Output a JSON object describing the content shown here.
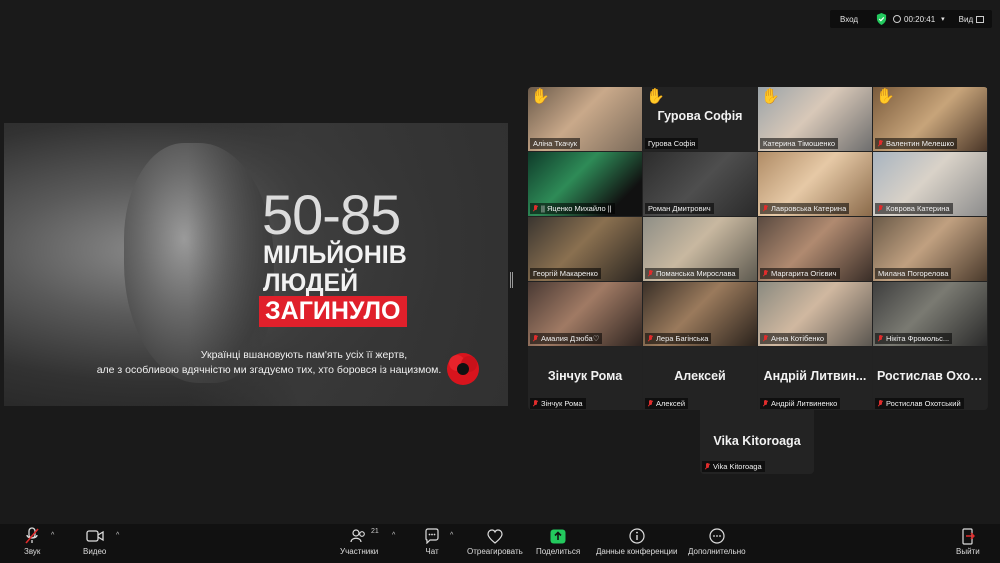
{
  "topbar": {
    "enter_label": "Вход",
    "timer": "00:20:41",
    "view_label": "Вид"
  },
  "share": {
    "number": "50-85",
    "line2": "МІЛЬЙОНІВ",
    "line3": "ЛЮДЕЙ",
    "line4": "ЗАГИНУЛО",
    "caption1": "Українці вшановують пам'ять усіх її жертв,",
    "caption2": "але з особливою вдячністю ми згадуємо тих, хто боровся із нацизмом."
  },
  "participants": [
    {
      "name": "Аліна Ткачук",
      "muted": false,
      "hand": true,
      "photo": "linear-gradient(135deg,#6b5a4a,#c9a98a 45%,#7a6a5a)"
    },
    {
      "name": "Гурова Софія",
      "muted": false,
      "hand": true,
      "display": "Гурова Софія"
    },
    {
      "name": "Катерина Тімошенко",
      "muted": false,
      "hand": true,
      "photo": "linear-gradient(135deg,#9aa3a8,#d8c8b8 45%,#6e6e6e)"
    },
    {
      "name": "Валентин Мелешко",
      "muted": true,
      "hand": true,
      "photo": "linear-gradient(135deg,#7a5b3c,#c7a47a 50%,#4a3628)"
    },
    {
      "name": "|| Яценко Михайло ||",
      "muted": true,
      "hand": false,
      "photo": "linear-gradient(135deg,#0f3b2a,#2e8b57 40%,#111 80%)"
    },
    {
      "name": "Роман Дмитрович",
      "muted": false,
      "hand": false,
      "photo": "linear-gradient(135deg,#2c2c2c,#4e4e4e 50%,#2a2a2a)"
    },
    {
      "name": "Лавровська Катерина",
      "muted": true,
      "hand": false,
      "photo": "linear-gradient(135deg,#b08c66,#e6c9a6 45%,#8a6a4a)"
    },
    {
      "name": "Коврова Катерина",
      "muted": true,
      "hand": false,
      "photo": "linear-gradient(135deg,#a8b4c0,#d9d2c8 45%,#8c8c8c)"
    },
    {
      "name": "Георгій Макаренко",
      "muted": false,
      "hand": false,
      "photo": "linear-gradient(135deg,#3a3530,#8a7050 45%,#2a2520)"
    },
    {
      "name": "Поманська Мирослава",
      "muted": true,
      "hand": false,
      "photo": "linear-gradient(135deg,#8e8e86,#c8b8a0 45%,#5e5a50)"
    },
    {
      "name": "Маргарита Огієвич",
      "muted": true,
      "hand": false,
      "photo": "linear-gradient(135deg,#5a4a40,#b08a70 45%,#3a2e28)"
    },
    {
      "name": "Милана Погорелова",
      "muted": false,
      "hand": false,
      "photo": "linear-gradient(135deg,#6a5a48,#c0a080 45%,#4a3a2c)"
    },
    {
      "name": "Амалия Дзюба♡",
      "muted": true,
      "hand": false,
      "photo": "linear-gradient(135deg,#4a3a34,#a07a64 45%,#2e2420)"
    },
    {
      "name": "Лера Багінська",
      "muted": true,
      "hand": false,
      "active": true,
      "photo": "linear-gradient(135deg,#3a3028,#9a7a5c 45%,#2a221c)"
    },
    {
      "name": "Анна Котібенко",
      "muted": true,
      "hand": false,
      "photo": "linear-gradient(135deg,#8a8a80,#d0b8a0 45%,#5a5650)"
    },
    {
      "name": "Нікіта Фромольс...",
      "muted": true,
      "hand": false,
      "photo": "linear-gradient(135deg,#3e3e3e,#7a7a72 45%,#2a2a2a)"
    },
    {
      "name": "Зінчук Рома",
      "muted": true,
      "hand": false,
      "display": "Зінчук Рома"
    },
    {
      "name": "Алексей",
      "muted": true,
      "hand": false,
      "display": "Алексей"
    },
    {
      "name": "Андрій Литвиненко",
      "muted": true,
      "hand": false,
      "display": "Андрій Литвин..."
    },
    {
      "name": "Ростислав Охотський",
      "muted": true,
      "hand": false,
      "display": "Ростислав Охот..."
    }
  ],
  "extra_participant": {
    "name": "Vika Kitoroaga",
    "display": "Vika Kitoroaga",
    "muted": true
  },
  "toolbar": {
    "audio": "Звук",
    "video": "Видео",
    "participants": "Участники",
    "participants_count": "21",
    "chat": "Чат",
    "react": "Отреагировать",
    "share": "Поделиться",
    "info": "Данные конференции",
    "more": "Дополнительно",
    "leave": "Выйти"
  }
}
